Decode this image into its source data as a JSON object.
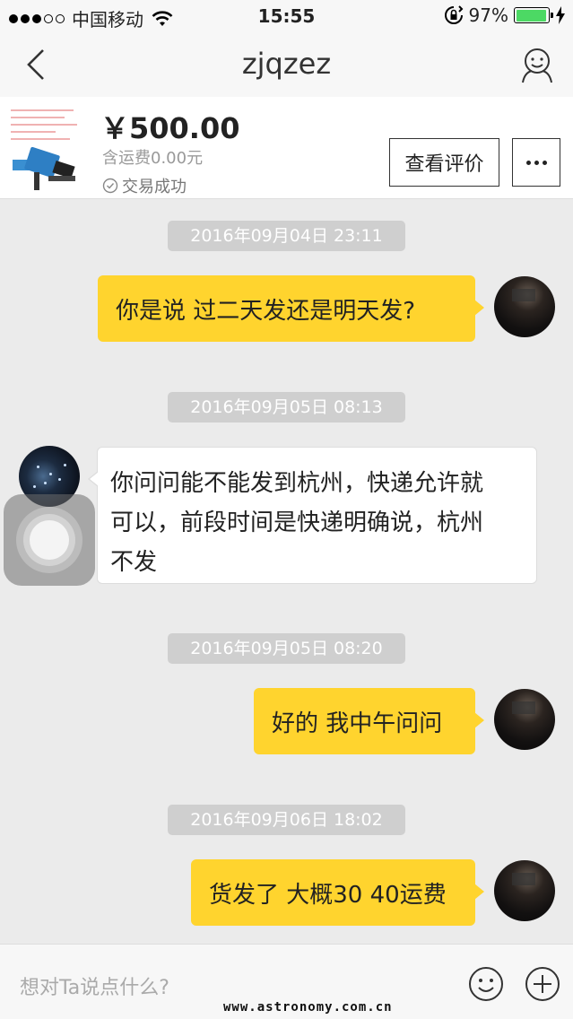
{
  "status_bar": {
    "carrier": "中国移动",
    "time": "15:55",
    "battery": "97%",
    "battery_level": 0.97,
    "signal_filled": 3,
    "signal_total": 5
  },
  "nav": {
    "title": "zjqzez"
  },
  "product": {
    "price": "￥500.00",
    "shipping": "含运费0.00元",
    "status": "交易成功",
    "review_button": "查看评价"
  },
  "messages": [
    {
      "timestamp": "2016年09月04日 23:11",
      "from": "self",
      "text": "你是说 过二天发还是明天发?"
    },
    {
      "timestamp": "2016年09月05日 08:13",
      "from": "other",
      "lines": [
        "你问问能不能发到杭州，快递允许就",
        "可以，前段时间是快递明确说，杭州",
        "不发"
      ]
    },
    {
      "timestamp": "2016年09月05日 08:20",
      "from": "self",
      "text": "好的 我中午问问"
    },
    {
      "timestamp": "2016年09月06日 18:02",
      "from": "self",
      "text": "货发了 大概30 40运费"
    }
  ],
  "input": {
    "placeholder": "想对Ta说点什么?"
  },
  "watermark": "www.astronomy.com.cn",
  "colors": {
    "bubble_self": "#ffd42e",
    "timestamp_bg": "#cfcfcf",
    "background": "#ebebeb"
  }
}
